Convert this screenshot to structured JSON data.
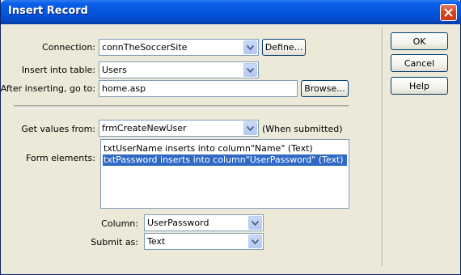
{
  "window": {
    "title": "Insert Record"
  },
  "connection": {
    "label": "Connection:",
    "value": "connTheSoccerSite",
    "define_label": "Define..."
  },
  "insert_into": {
    "label": "Insert into table:",
    "value": "Users"
  },
  "after_insert": {
    "label": "After inserting, go to:",
    "value": "home.asp",
    "browse_label": "Browse..."
  },
  "get_values": {
    "label": "Get values from:",
    "value": "frmCreateNewUser",
    "note": "(When submitted)"
  },
  "form_elements": {
    "label": "Form elements:",
    "items": [
      "txtUserName inserts into column\"Name\" (Text)",
      "txtPassword inserts into column\"UserPassword\" (Text)"
    ],
    "selected_index": 1
  },
  "column": {
    "label": "Column:",
    "value": "UserPassword"
  },
  "submit_as": {
    "label": "Submit as:",
    "value": "Text"
  },
  "buttons": {
    "ok": "OK",
    "cancel": "Cancel",
    "help": "Help"
  },
  "colors": {
    "titlebar": "#0453dd",
    "selection": "#316ac5",
    "dialog_bg": "#ece9d8"
  },
  "icons": {
    "close": "close-icon",
    "dropdown": "chevron-down-icon"
  }
}
